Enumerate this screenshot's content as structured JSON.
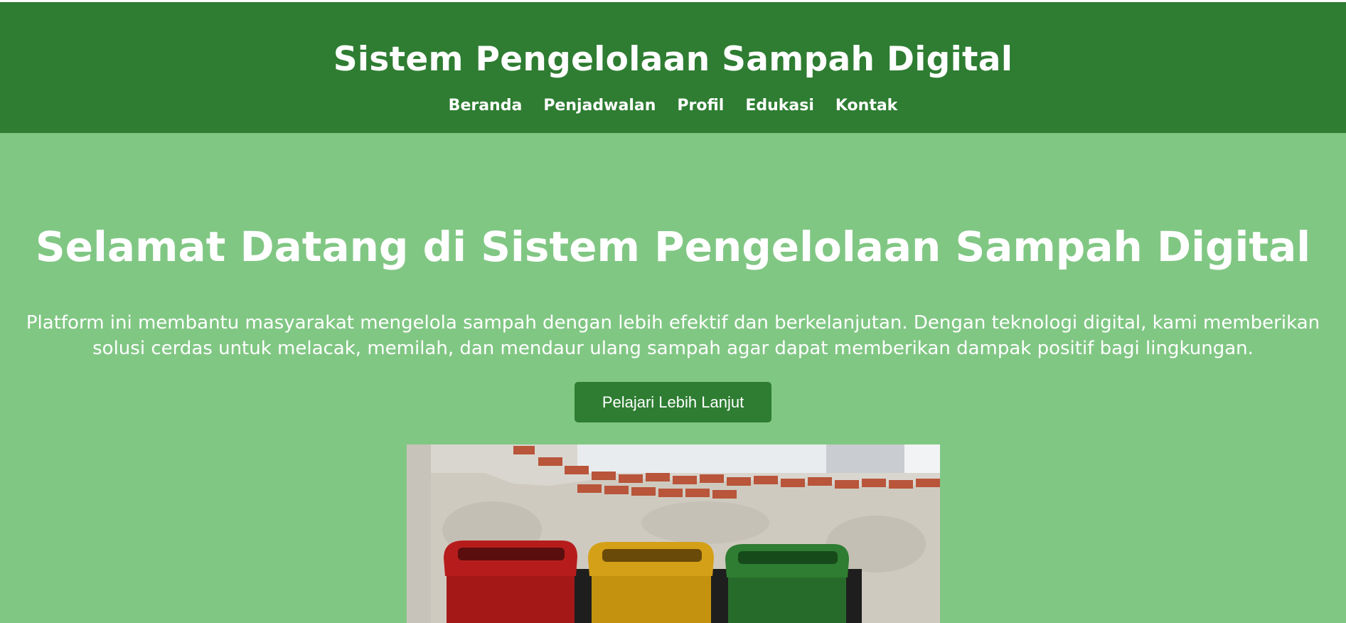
{
  "header": {
    "title": "Sistem Pengelolaan Sampah Digital",
    "nav": [
      "Beranda",
      "Penjadwalan",
      "Profil",
      "Edukasi",
      "Kontak"
    ]
  },
  "hero": {
    "title": "Selamat Datang di Sistem Pengelolaan Sampah Digital",
    "description": "Platform ini membantu masyarakat mengelola sampah dengan lebih efektif dan berkelanjutan. Dengan teknologi digital, kami memberikan solusi cerdas untuk melacak, memilah, dan mendaur ulang sampah agar dapat memberikan dampak positif bagi lingkungan.",
    "button_label": "Pelajari Lebih Lanjut",
    "image": "recycling-bins-photo"
  },
  "colors": {
    "header_bg": "#2e7d32",
    "page_bg": "#81c784",
    "button_bg": "#2e7d32",
    "text": "#ffffff"
  }
}
